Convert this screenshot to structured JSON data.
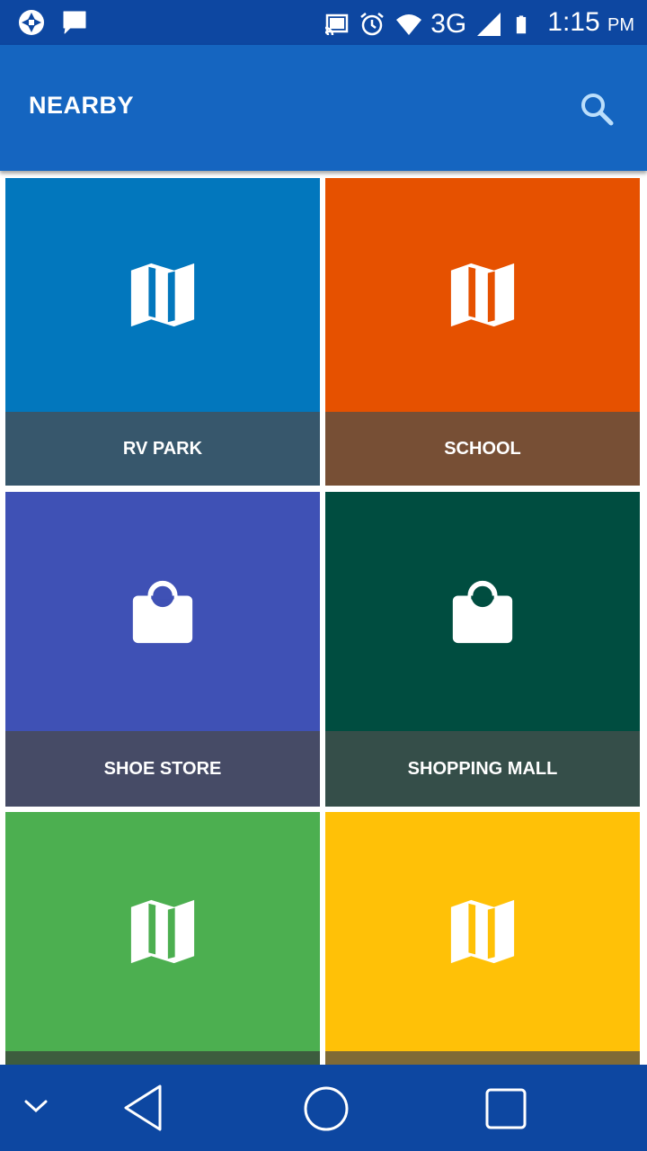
{
  "status_bar": {
    "network": "3G",
    "time": "1:15",
    "ampm": "PM"
  },
  "app_bar": {
    "title": "NEARBY"
  },
  "tiles": [
    {
      "label": "RV PARK",
      "icon": "map-icon",
      "top_color": "#0277BD",
      "bottom_color": "#37576C"
    },
    {
      "label": "SCHOOL",
      "icon": "map-icon",
      "top_color": "#E65100",
      "bottom_color": "#774F35"
    },
    {
      "label": "SHOE STORE",
      "icon": "shopping-bag-icon",
      "top_color": "#3F51B5",
      "bottom_color": "#464B66"
    },
    {
      "label": "SHOPPING MALL",
      "icon": "shopping-bag-icon",
      "top_color": "#004D40",
      "bottom_color": "#354E49"
    },
    {
      "label": "",
      "icon": "map-icon",
      "top_color": "#4CAF50",
      "bottom_color": "#3D5C3E"
    },
    {
      "label": "",
      "icon": "map-icon",
      "top_color": "#FFC107",
      "bottom_color": "#7F6A36"
    }
  ]
}
